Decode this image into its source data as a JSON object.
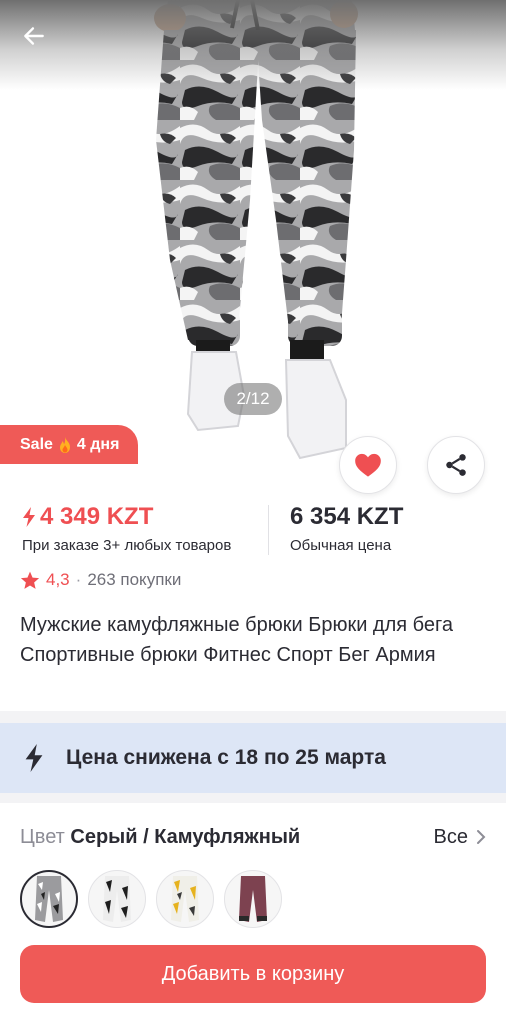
{
  "gallery": {
    "counter": "2/12",
    "sale_badge": {
      "label": "Sale",
      "icon": "fire-icon",
      "days": "4 дня"
    }
  },
  "price": {
    "sale_value": "4 349 KZT",
    "sale_note": "При заказе 3+ любых товаров",
    "regular_value": "6 354 KZT",
    "regular_note": "Обычная цена"
  },
  "rating": {
    "score": "4,3",
    "separator": "·",
    "purchases": "263 покупки"
  },
  "product": {
    "title": "Мужские камуфляжные брюки Брюки для бега Спортивные брюки Фитнес Спорт Бег Армия"
  },
  "promo": {
    "text": "Цена снижена с 18 по 25 марта"
  },
  "variant": {
    "color_key": "Цвет",
    "color_value": "Серый / Камуфляжный",
    "all_label": "Все",
    "swatches": [
      "grey-camo",
      "black-white-camo",
      "yellow-camo",
      "burgundy"
    ]
  },
  "cta": {
    "label": "Добавить в корзину"
  },
  "colors": {
    "accent": "#ef5a57",
    "price_red": "#ef4f52",
    "promo_bg": "#dde6f6"
  }
}
